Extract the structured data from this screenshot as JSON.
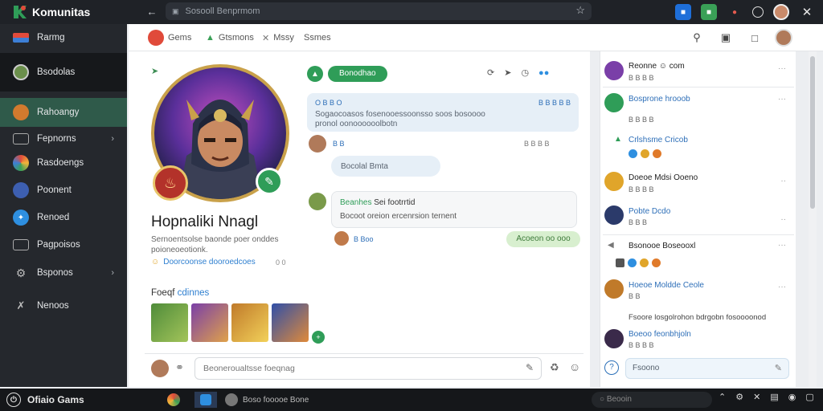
{
  "app": {
    "title": "Komunitas"
  },
  "urlbar": {
    "text": "Sosooll Benprmom"
  },
  "sidebar": {
    "items": [
      {
        "label": "Rarmg"
      },
      {
        "label": "Bsodolas"
      },
      {
        "label": "Rahoangy"
      },
      {
        "label": "Fepnorns"
      },
      {
        "label": "Rasdoengs"
      },
      {
        "label": "Poonent"
      },
      {
        "label": "Renoed"
      },
      {
        "label": "Pagpoisos"
      },
      {
        "label": "Bsponos"
      },
      {
        "label": "Nenoos"
      }
    ]
  },
  "header": {
    "tabs": [
      {
        "label": "Gems"
      },
      {
        "label": "Gtsmons"
      },
      {
        "label": "Mssy"
      },
      {
        "label": "Ssmes"
      }
    ]
  },
  "profile": {
    "name": "Hopnaliki Nnagl",
    "bio": "Sernoentsolse baonde poer onddes poioneoeotionk.",
    "link": "Doorcoonse dooroedcoes",
    "count": "0 0",
    "friends_label": "Foeqf",
    "friends_highlight": "cdinnes",
    "friends_more": "+"
  },
  "chat": {
    "pill": "Bonodhao",
    "messages": [
      {
        "header": "O  B B O",
        "header_right": "B B B B B",
        "body": "Sogaocoasos fosenooessoonsso soos bosoooo pronol oonoooooolbotn"
      },
      {
        "meta_left": "B  B",
        "meta_right": "B B  B B"
      },
      {
        "body": "Bocolal Bmta"
      },
      {
        "title_green": "Beanhes",
        "title": "Sei footrrtid",
        "body": "Bocoot oreion ercenrsion ternent"
      },
      {
        "meta": "B  Boo",
        "pill": "Acoeon oo ooo"
      }
    ],
    "compose_placeholder": "Beoneroualtsse foeqnag"
  },
  "right_list": [
    {
      "title": "Reonne ☺ com",
      "sub": "B  B B B"
    },
    {
      "title": "Bosprone hrooob",
      "sub": "B B B B"
    },
    {
      "title": "Crlshsme Cricob",
      "sub": ""
    },
    {
      "title": "Doeoe Mdsi Ooeno",
      "sub": "B B B B"
    },
    {
      "title": "Pobte Dcdo",
      "sub": "B B B"
    },
    {
      "title": "Bsonooe Boseooxl",
      "sub": ""
    },
    {
      "title": "Hoeoe Moldde Ceole",
      "sub": "B B"
    },
    {
      "title": "Fsoore losgolrohon bdrgobn fosoooonod",
      "sub": ""
    },
    {
      "title": "Boeoo feonbhjoln",
      "sub": "B  B B B"
    }
  ],
  "right_compose": {
    "placeholder": "Fsoono"
  },
  "taskbar": {
    "brand": "Ofiaio Gams",
    "app_label": "Boso fooooe Bone",
    "search": "Beooin"
  },
  "colors": {
    "accent_green": "#2f9d58",
    "sidebar_bg": "#25282d",
    "link_blue": "#2e7fd0"
  }
}
